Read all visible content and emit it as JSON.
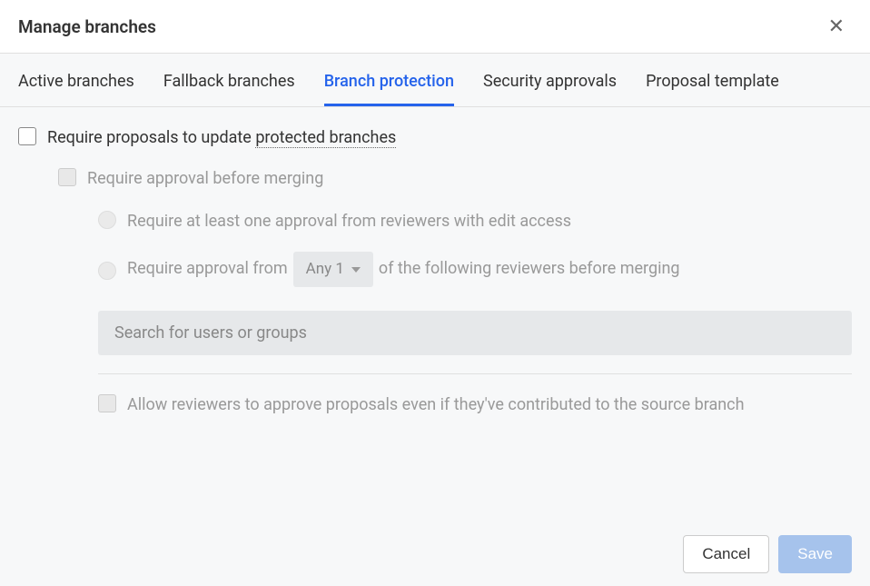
{
  "header": {
    "title": "Manage branches"
  },
  "tabs": {
    "active_branches": "Active branches",
    "fallback_branches": "Fallback branches",
    "branch_protection": "Branch protection",
    "security_approvals": "Security approvals",
    "proposal_template": "Proposal template"
  },
  "options": {
    "require_proposals_prefix": "Require proposals to update ",
    "require_proposals_dotted": "protected branches",
    "require_approval": "Require approval before merging",
    "require_one_approval": "Require at least one approval from reviewers with edit access",
    "require_approval_from_prefix": "Require approval from",
    "require_approval_from_suffix": "of the following reviewers before merging",
    "approval_count": "Any 1",
    "search_placeholder": "Search for users or groups",
    "allow_contributors": "Allow reviewers to approve proposals even if they've contributed to the source branch"
  },
  "footer": {
    "cancel": "Cancel",
    "save": "Save"
  }
}
